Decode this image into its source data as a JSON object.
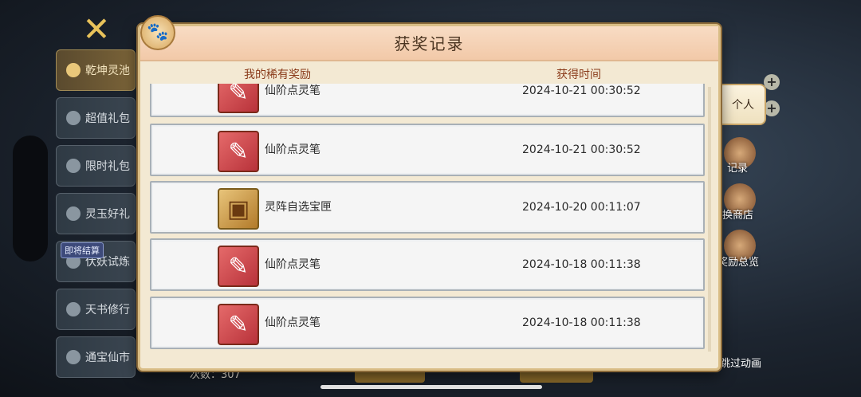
{
  "sidebar": {
    "items": [
      {
        "label": "乾坤灵池",
        "active": true
      },
      {
        "label": "超值礼包",
        "active": false
      },
      {
        "label": "限时礼包",
        "active": false
      },
      {
        "label": "灵玉好礼",
        "active": false
      },
      {
        "label": "伏妖试炼",
        "active": false
      },
      {
        "label": "天书修行",
        "active": false
      },
      {
        "label": "通宝仙市",
        "active": false
      }
    ],
    "badge": "即将结算"
  },
  "right": {
    "tab_label": "个人",
    "link_record": "记录",
    "link_shop": "换商店",
    "link_rewards": "奖励总览",
    "skip_label": "跳过动画"
  },
  "footer": {
    "count_text": "次数：307"
  },
  "dialog": {
    "title": "获奖记录",
    "col_reward": "我的稀有奖励",
    "col_time": "获得时间",
    "rows": [
      {
        "name": "仙阶点灵笔",
        "time": "2024-10-21 00:30:52",
        "icon": "brush-icon"
      },
      {
        "name": "仙阶点灵笔",
        "time": "2024-10-21 00:30:52",
        "icon": "brush-icon"
      },
      {
        "name": "灵阵自选宝匣",
        "time": "2024-10-20 00:11:07",
        "icon": "chest-icon"
      },
      {
        "name": "仙阶点灵笔",
        "time": "2024-10-18 00:11:38",
        "icon": "brush-icon"
      },
      {
        "name": "仙阶点灵笔",
        "time": "2024-10-18 00:11:38",
        "icon": "brush-icon"
      }
    ]
  },
  "colors": {
    "accent": "#8a3b1a",
    "header_bg": "#f2c9a8",
    "panel_bg": "#f3e9d3",
    "row_bg": "#f5f5f5"
  }
}
